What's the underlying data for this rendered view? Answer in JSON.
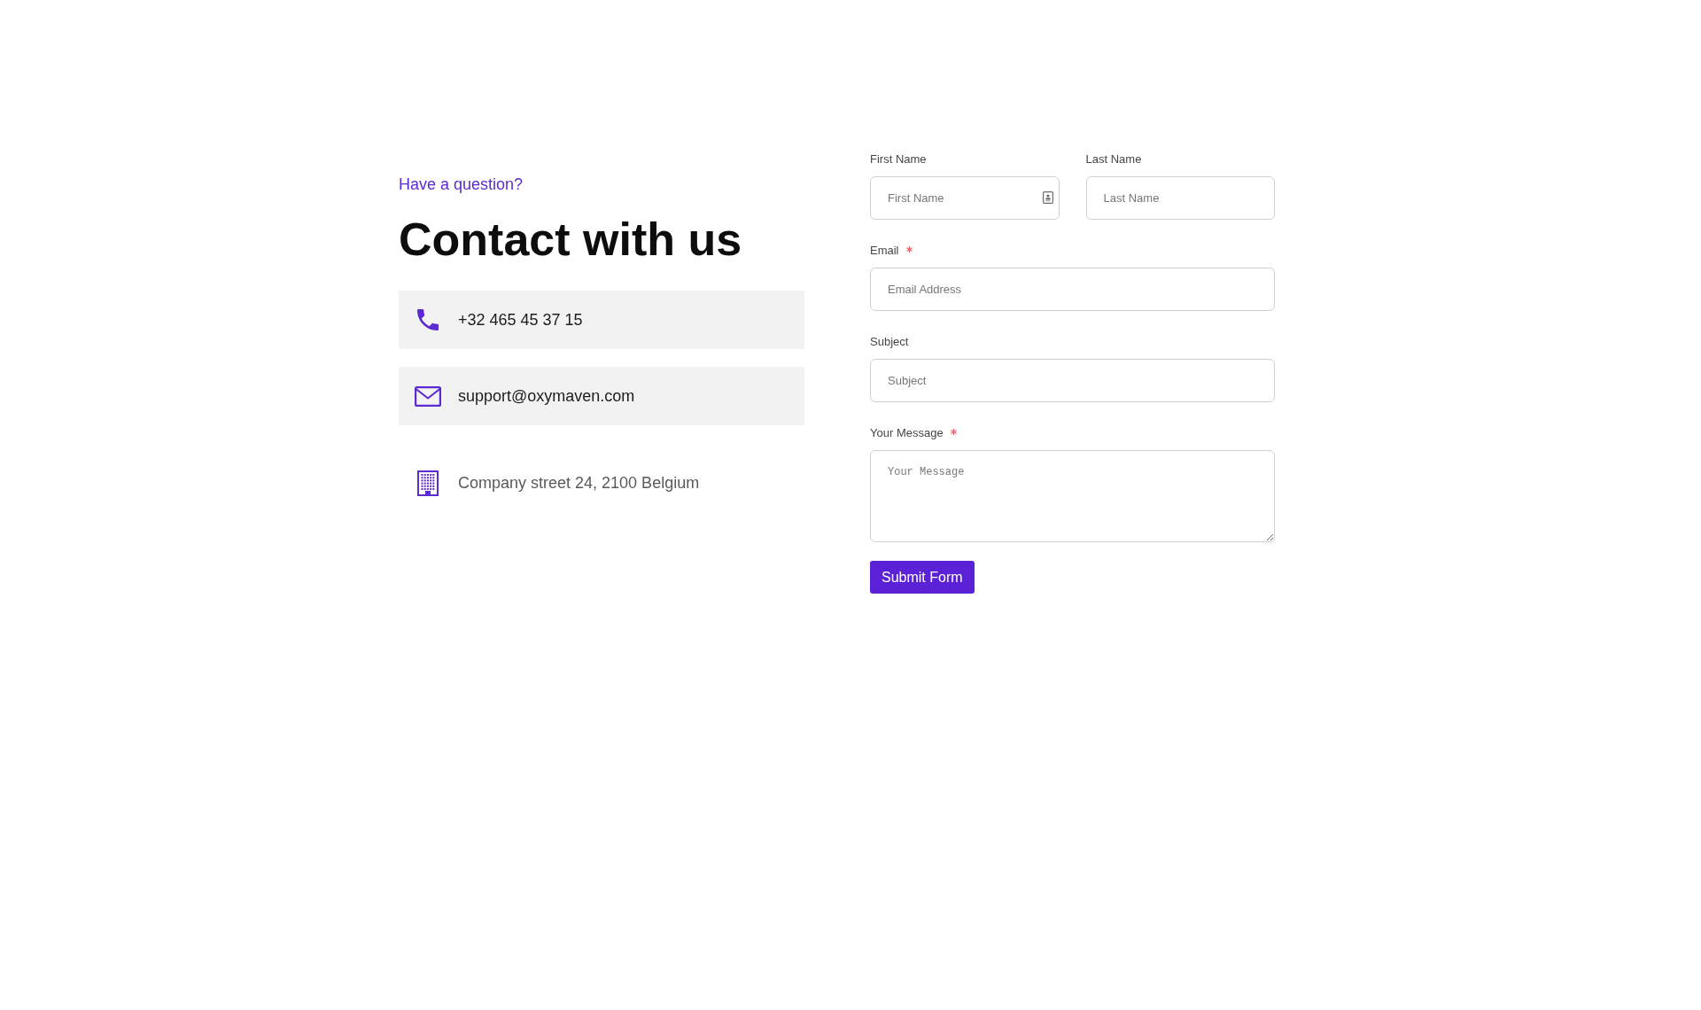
{
  "intro": {
    "eyebrow": "Have a question?",
    "heading": "Contact with us"
  },
  "contact_items": [
    {
      "kind": "phone",
      "text": "+32 465 45 37 15"
    },
    {
      "kind": "email",
      "text": "support@oxymaven.com"
    },
    {
      "kind": "address",
      "text": "Company street 24, 2100 Belgium"
    }
  ],
  "form": {
    "rows": [
      {
        "fields": [
          {
            "kind": "input",
            "label": "First Name",
            "placeholder": "First Name",
            "required": false,
            "autofill_icon": true
          },
          {
            "kind": "input",
            "label": "Last Name",
            "placeholder": "Last Name",
            "required": false,
            "autofill_icon": false
          }
        ]
      },
      {
        "fields": [
          {
            "kind": "input",
            "label": "Email",
            "placeholder": "Email Address",
            "required": true,
            "autofill_icon": false
          }
        ]
      },
      {
        "fields": [
          {
            "kind": "input",
            "label": "Subject",
            "placeholder": "Subject",
            "required": false,
            "autofill_icon": false
          }
        ]
      },
      {
        "fields": [
          {
            "kind": "textarea",
            "label": "Your Message",
            "placeholder": "Your Message",
            "required": true,
            "autofill_icon": false
          }
        ]
      }
    ],
    "submit_button": "Submit Form"
  }
}
